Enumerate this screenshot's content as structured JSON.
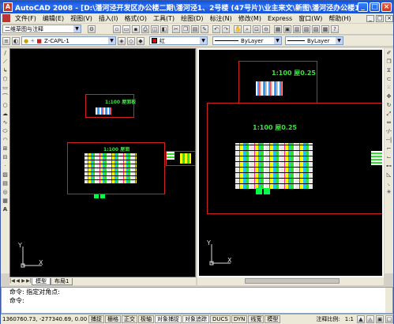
{
  "window": {
    "app_icon": "A",
    "title": "AutoCAD 2008 - [D:\\潘河泾开发区办公楼二期\\潘河泾1、2号楼 (47号片)\\业主来文\\新图\\潘河泾办公楼1、2号楼图纸\\1、2...",
    "minimize": "_",
    "maximize": "□",
    "close": "×"
  },
  "menu": {
    "items": [
      "文件(F)",
      "编辑(E)",
      "视图(V)",
      "插入(I)",
      "格式(O)",
      "工具(T)",
      "绘图(D)",
      "标注(N)",
      "修改(M)",
      "Express",
      "窗口(W)",
      "帮助(H)"
    ],
    "doc_controls": [
      "_",
      "□",
      "×"
    ]
  },
  "toolbar1": {
    "workspace_label": "二维草图与注释"
  },
  "toolbar2": {
    "layer_label": "Z-CAPL-1",
    "color_label": "红",
    "linetype_label": "ByLayer",
    "lineweight_label": "ByLayer"
  },
  "viewport_left": {
    "sheet_title_top": "1:100 屋面板",
    "sheet_title_main": "1:100 屋面"
  },
  "viewport_right": {
    "sheet_title_top": "1:100 屋0.25",
    "sheet_title_main": "1:100 屋0.25"
  },
  "ucs": {
    "x": "X",
    "y": "Y"
  },
  "tabs": [
    "模型",
    "布局1"
  ],
  "tab_nav": [
    "|◀",
    "◀",
    "▶",
    "▶|"
  ],
  "command": {
    "lines": [
      "命令: 指定对角点:",
      "命令:"
    ]
  },
  "status": {
    "coords": "1360760.73, -277340.69, 0.00",
    "buttons": [
      "捕捉",
      "栅格",
      "正交",
      "极轴",
      "对象捕捉",
      "对象追踪",
      "DUCS",
      "DYN",
      "线宽",
      "模型"
    ],
    "scale_label": "注释比例:",
    "scale_value": "1:1"
  },
  "colors": {
    "frame_red": "#d02020",
    "text_green": "#3de23d",
    "canvas_bg": "#000000"
  },
  "icons": {
    "left_tools": [
      "line-icon",
      "construction-line-icon",
      "polyline-icon",
      "polygon-icon",
      "rectangle-icon",
      "arc-icon",
      "circle-icon",
      "revcloud-icon",
      "spline-icon",
      "ellipse-icon",
      "ellipse-arc-icon",
      "insert-block-icon",
      "make-block-icon",
      "point-icon",
      "hatch-icon",
      "gradient-icon",
      "region-icon",
      "table-icon",
      "mtext-icon"
    ],
    "right_tools": [
      "erase-icon",
      "copy-icon",
      "mirror-icon",
      "offset-icon",
      "array-icon",
      "move-icon",
      "rotate-icon",
      "scale-icon",
      "stretch-icon",
      "trim-icon",
      "extend-icon",
      "break-point-icon",
      "break-icon",
      "join-icon",
      "chamfer-icon",
      "fillet-icon",
      "explode-icon"
    ]
  }
}
